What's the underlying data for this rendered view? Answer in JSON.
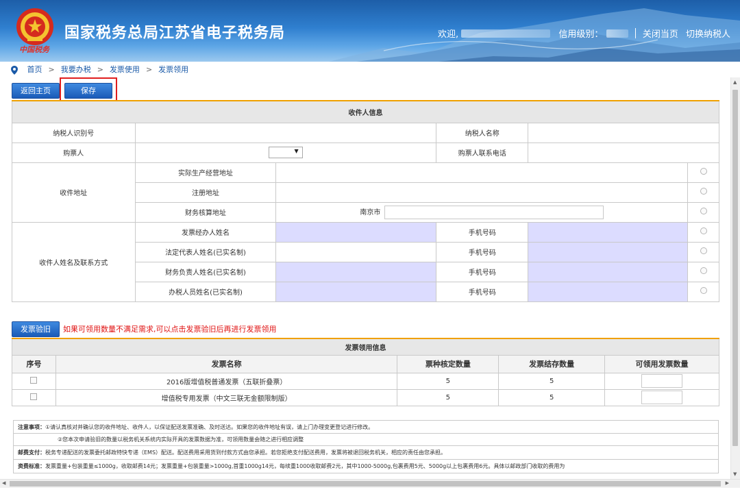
{
  "header": {
    "site_title": "国家税务总局江苏省电子税务局",
    "logo_script": "中国税务",
    "welcome_label": "欢迎,",
    "credit_label": "信用级别：",
    "close_label": "关闭当页",
    "switch_label": "切换纳税人"
  },
  "breadcrumb": {
    "items": [
      "首页",
      "我要办税",
      "发票使用",
      "发票领用"
    ],
    "separator": ">"
  },
  "buttons": {
    "back_home": "返回主页",
    "save": "保存",
    "verify_old": "发票验旧"
  },
  "recipient": {
    "section_title": "收件人信息",
    "taxpayer_id_label": "纳税人识别号",
    "taxpayer_id_value": "",
    "taxpayer_name_label": "纳税人名称",
    "taxpayer_name_value": "",
    "buyer_label": "购票人",
    "buyer_select_value": "",
    "buyer_select_arrow": "▼",
    "buyer_phone_label": "购票人联系电话",
    "buyer_phone_value": "",
    "address_group_label": "收件地址",
    "address_rows": [
      {
        "label": "实际生产经营地址",
        "value": ""
      },
      {
        "label": "注册地址",
        "value": ""
      },
      {
        "label": "财务核算地址",
        "city": "南京市",
        "value": ""
      }
    ],
    "contact_group_label": "收件人姓名及联系方式",
    "phone_label": "手机号码",
    "contact_rows": [
      {
        "label": "发票经办人姓名",
        "name": "",
        "phone": ""
      },
      {
        "label": "法定代表人姓名(已实名制)",
        "name": "",
        "phone": ""
      },
      {
        "label": "财务负责人姓名(已实名制)",
        "name": "",
        "phone": ""
      },
      {
        "label": "办税人员姓名(已实名制)",
        "name": "",
        "phone": ""
      }
    ]
  },
  "warning_text": "如果可领用数量不满足需求,可以点击发票验旧后再进行发票领用",
  "invoice": {
    "section_title": "发票领用信息",
    "columns": [
      "序号",
      "发票名称",
      "票种核定数量",
      "发票结存数量",
      "可领用发票数量"
    ],
    "rows": [
      {
        "name": "2016版增值税普通发票（五联折叠票）",
        "approved": "5",
        "stock": "5",
        "available": ""
      },
      {
        "name": "增值税专用发票（中文三联无金额限制版）",
        "approved": "5",
        "stock": "5",
        "available": ""
      }
    ]
  },
  "notes": {
    "notice_label": "注意事项：",
    "notice_1": "①请认真核对并确认您的收件地址、收件人，以保证配送发票准确、及时送达。如果您的收件地址有误，请上门办理变更登记进行修改。",
    "notice_2": "②您本次申请验旧的数量以税务机关系统内实际开具的发票数据为准，可领用数量会随之进行相应调整",
    "postage_label": "邮费支付：",
    "postage_text": "税务专递配送的发票委托邮政特快专递（EMS）配送。配送费用采用货到付款方式由您承担。若您拒绝支付配送费用，发票将被退回税务机关，相应的责任由您承担。",
    "fee_label": "资费标准：",
    "fee_text": "发票重量+包装重量≤1000g，收取邮费14元；发票重量+包装重量>1000g,首重1000g14元，每续重1000收取邮费2元，其中1000-5000g,包裹费用5元、5000g以上包裹费用6元。具体以邮政部门收取的费用为"
  }
}
